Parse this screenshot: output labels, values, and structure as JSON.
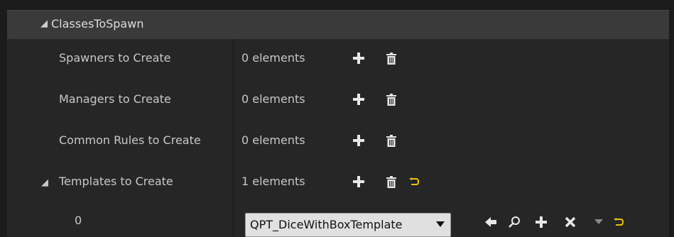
{
  "category": {
    "title": "ClassesToSpawn"
  },
  "rows": [
    {
      "label": "Spawners to Create",
      "value": "0 elements"
    },
    {
      "label": "Managers to Create",
      "value": "0 elements"
    },
    {
      "label": "Common Rules to Create",
      "value": "0 elements"
    },
    {
      "label": "Templates to Create",
      "value": "1 elements"
    }
  ],
  "element": {
    "index": "0",
    "selected": "QPT_DiceWithBoxTemplate"
  },
  "icons": {
    "add": "plus-icon",
    "remove": "trash-icon",
    "reset": "reset-to-default-icon",
    "browse": "arrow-left-icon",
    "find": "search-icon",
    "clear": "close-icon",
    "expand": "triangle-down-icon"
  },
  "colors": {
    "accent": "#e6c400",
    "panel": "#262626",
    "header": "#3a3a3a"
  }
}
